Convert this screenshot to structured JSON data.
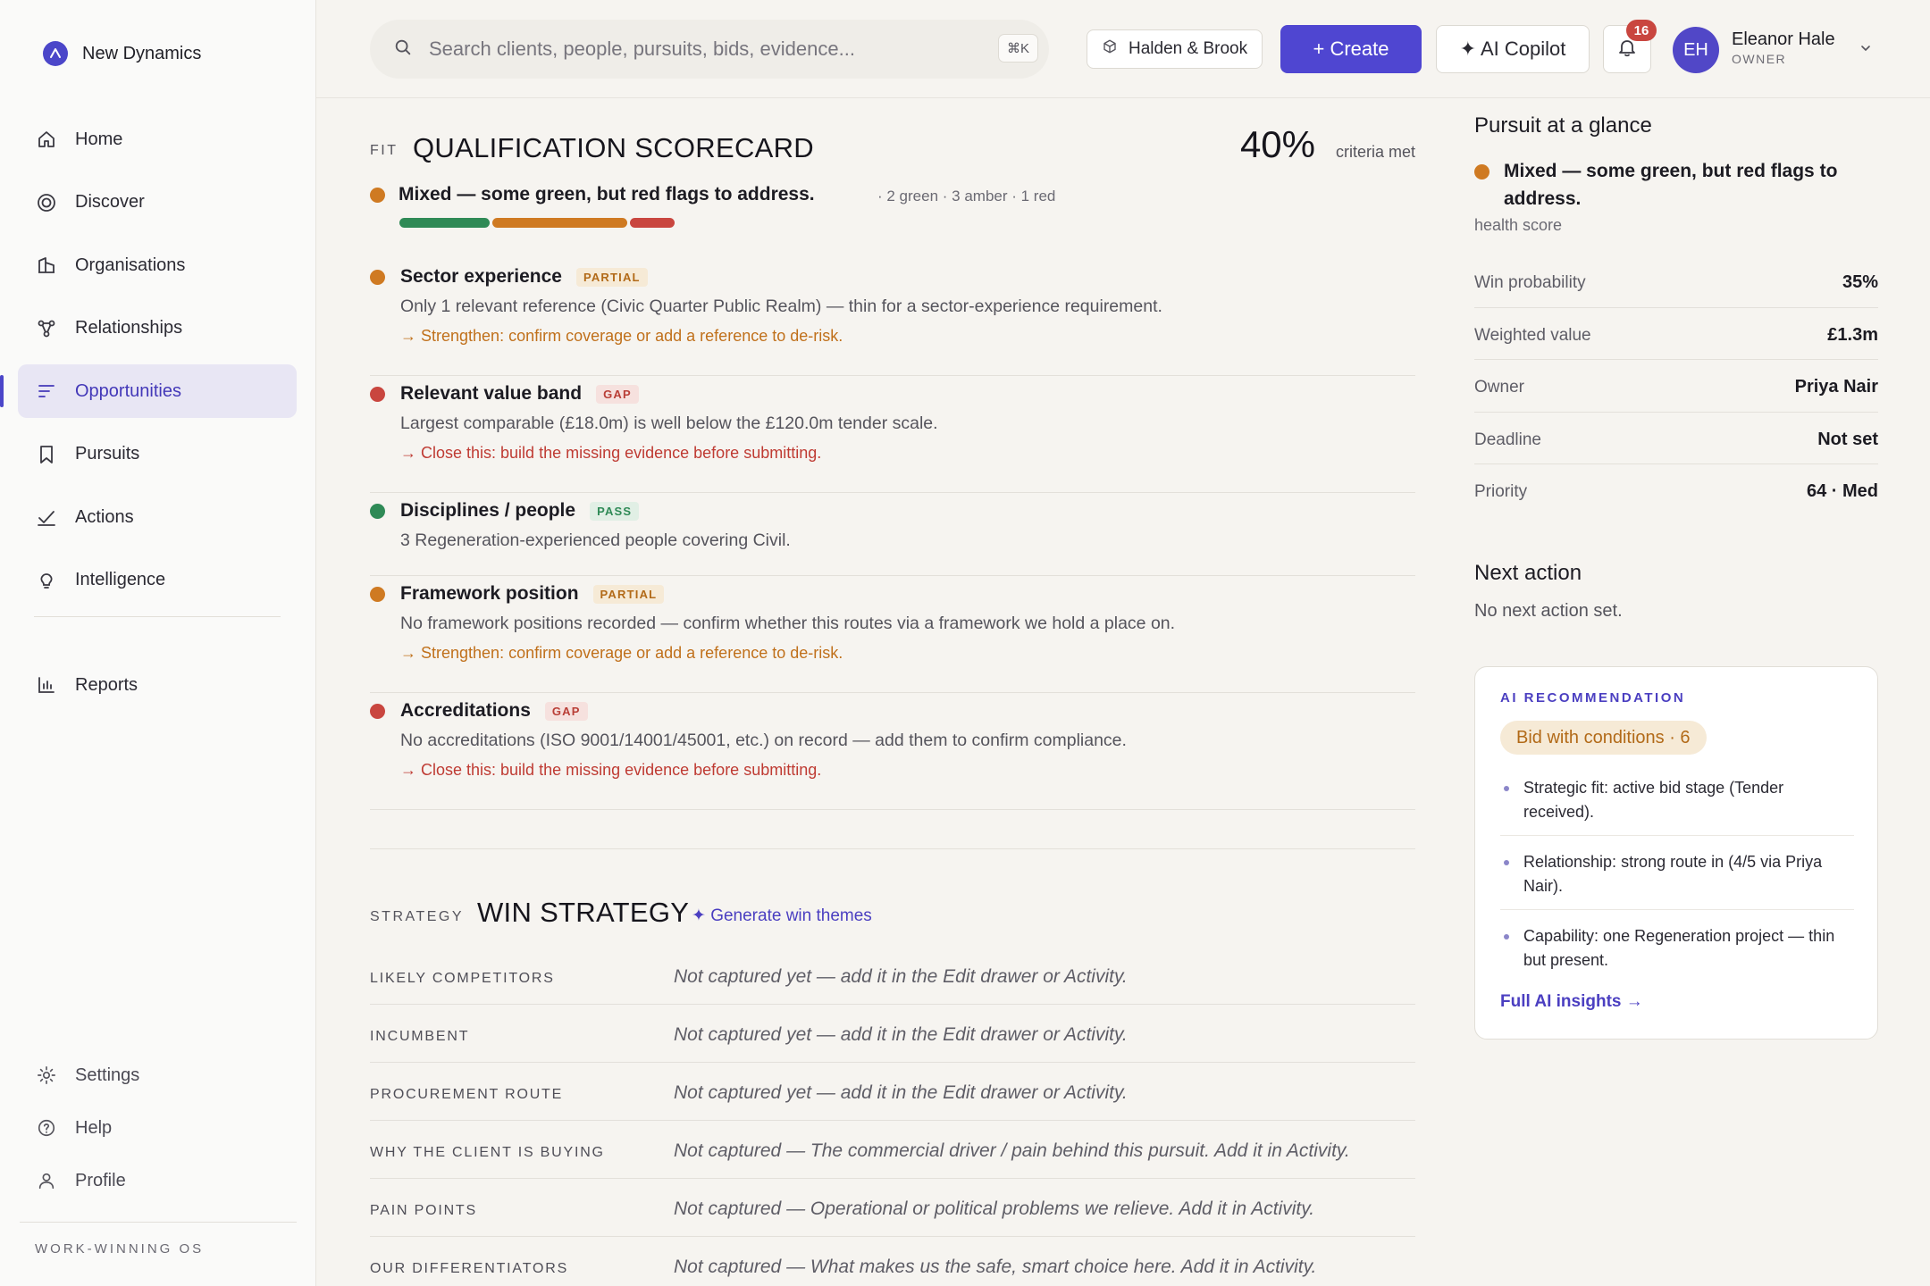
{
  "brand": {
    "name": "New Dynamics"
  },
  "nav": {
    "items": [
      {
        "label": "Home",
        "icon": "home-icon"
      },
      {
        "label": "Discover",
        "icon": "target-icon"
      },
      {
        "label": "Organisations",
        "icon": "building-icon"
      },
      {
        "label": "Relationships",
        "icon": "network-icon"
      },
      {
        "label": "Opportunities",
        "icon": "list-icon",
        "active": true
      },
      {
        "label": "Pursuits",
        "icon": "bookmark-icon"
      },
      {
        "label": "Actions",
        "icon": "check-icon"
      },
      {
        "label": "Intelligence",
        "icon": "lightbulb-icon"
      }
    ],
    "reports": "Reports",
    "bottom": [
      "Settings",
      "Help",
      "Profile"
    ],
    "footer_tag": "WORK-WINNING OS"
  },
  "topbar": {
    "search_placeholder": "Search clients, people, pursuits, bids, evidence...",
    "shortcut": "⌘K",
    "org": "Halden & Brook",
    "create_label": "+ Create",
    "copilot_label": "✦ AI Copilot",
    "notifications": "16",
    "user": {
      "initials": "EH",
      "name": "Eleanor Hale",
      "role": "OWNER"
    }
  },
  "scorecard": {
    "tag": "FIT",
    "title": "QUALIFICATION SCORECARD",
    "percent": "40%",
    "percent_label": "criteria met",
    "summary": "Mixed — some green, but red flags to address.",
    "counts": "· 2 green · 3 amber · 1 red",
    "bar": {
      "green": 2,
      "amber": 3,
      "red": 1
    },
    "criteria": [
      {
        "status": "amber",
        "name": "Sector experience",
        "badge": "PARTIAL",
        "badge_type": "partial",
        "desc": "Only 1 relevant reference (Civic Quarter Public Realm) — thin for a sector-experience requirement.",
        "action": "→ Strengthen: confirm coverage or add a reference to de-risk."
      },
      {
        "status": "red",
        "name": "Relevant value band",
        "badge": "GAP",
        "badge_type": "gap",
        "desc": "Largest comparable (£18.0m) is well below the £120.0m tender scale.",
        "action": "→ Close this: build the missing evidence before submitting."
      },
      {
        "status": "green",
        "name": "Disciplines / people",
        "badge": "PASS",
        "badge_type": "pass",
        "desc": "3 Regeneration-experienced people covering Civil.",
        "action": ""
      },
      {
        "status": "amber",
        "name": "Framework position",
        "badge": "PARTIAL",
        "badge_type": "partial",
        "desc": "No framework positions recorded — confirm whether this routes via a framework we hold a place on.",
        "action": "→ Strengthen: confirm coverage or add a reference to de-risk."
      },
      {
        "status": "red",
        "name": "Accreditations",
        "badge": "GAP",
        "badge_type": "gap",
        "desc": "No accreditations (ISO 9001/14001/45001, etc.) on record — add them to confirm compliance.",
        "action": "→ Close this: build the missing evidence before submitting."
      }
    ]
  },
  "strategy": {
    "tag": "STRATEGY",
    "title": "WIN STRATEGY",
    "generate_label": "✦ Generate win themes",
    "rows": [
      {
        "label": "LIKELY COMPETITORS",
        "value": "Not captured yet — add it in the Edit drawer or Activity."
      },
      {
        "label": "INCUMBENT",
        "value": "Not captured yet — add it in the Edit drawer or Activity."
      },
      {
        "label": "PROCUREMENT ROUTE",
        "value": "Not captured yet — add it in the Edit drawer or Activity."
      },
      {
        "label": "WHY THE CLIENT IS BUYING",
        "value": "Not captured — The commercial driver / pain behind this pursuit. Add it in Activity."
      },
      {
        "label": "PAIN POINTS",
        "value": "Not captured — Operational or political problems we relieve. Add it in Activity."
      },
      {
        "label": "OUR DIFFERENTIATORS",
        "value": "Not captured — What makes us the safe, smart choice here. Add it in Activity."
      }
    ]
  },
  "glance": {
    "title": "Pursuit at a glance",
    "health": "Mixed — some green, but red flags to address.",
    "health_label": "health score",
    "rows": [
      {
        "key": "Win probability",
        "value": "35%"
      },
      {
        "key": "Weighted value",
        "value": "£1.3m"
      },
      {
        "key": "Owner",
        "value": "Priya Nair"
      },
      {
        "key": "Deadline",
        "value": "Not set"
      },
      {
        "key": "Priority",
        "value": "64 · Med"
      }
    ],
    "next_action_title": "Next action",
    "next_action_text": "No next action set."
  },
  "ai": {
    "tag": "AI RECOMMENDATION",
    "pill": "Bid with conditions · 6",
    "points": [
      "Strategic fit: active bid stage (Tender received).",
      "Relationship: strong route in (4/5 via Priya Nair).",
      "Capability: one Regeneration project — thin but present."
    ],
    "link": "Full AI insights →"
  },
  "colors": {
    "accent": "#4f46d1",
    "green": "#2f8a56",
    "amber": "#cf7a22",
    "red": "#c9463f"
  }
}
